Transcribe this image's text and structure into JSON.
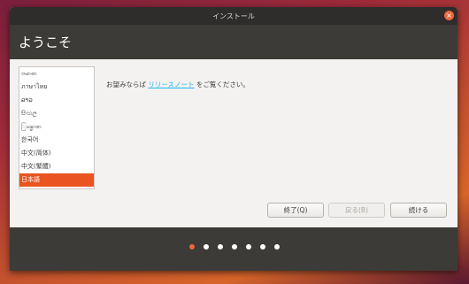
{
  "window": {
    "title": "インストール"
  },
  "header": {
    "title": "ようこそ"
  },
  "languages": [
    "ဗမာစာ",
    "ภาษาไทย",
    "ລາວ",
    "සිංහල",
    "ြမန္မာစာ",
    "한국어",
    "中文(简体)",
    "中文(繁體)",
    "日本語"
  ],
  "selected_language": "日本語",
  "note": {
    "prefix": "お望みならば ",
    "link": "リリースノート",
    "suffix": " をご覧ください。"
  },
  "buttons": {
    "quit": "終了(Q)",
    "back": "戻る(B)",
    "continue": "続ける"
  },
  "progress": {
    "total_steps": 7,
    "current_step": 1
  },
  "colors": {
    "accent": "#E95420",
    "header_bg": "#3C3B37",
    "titlebar_bg": "#2E2D2B",
    "link": "#19B6EE"
  }
}
